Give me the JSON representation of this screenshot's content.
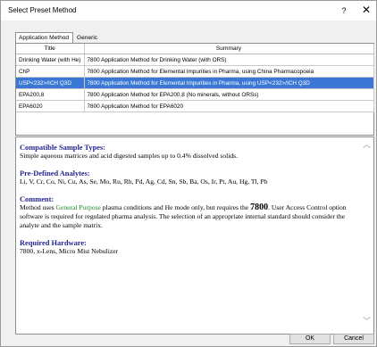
{
  "window": {
    "title": "Select Preset Method",
    "help_glyph": "?",
    "close_glyph": "✕"
  },
  "tabs": [
    {
      "label": "Application Method"
    },
    {
      "label": "Generic Method"
    }
  ],
  "table": {
    "headers": [
      "Title",
      "Summary"
    ],
    "rows": [
      {
        "title": "Drinking Water (with He)",
        "summary": "7800 Application Method for Drinking Water (with ORS)"
      },
      {
        "title": "ChP",
        "summary": "7800 Application Method for Elemental Impurities in Pharma, using China Pharmacopoeia"
      },
      {
        "title": "USP<232>/ICH Q3D",
        "summary": "7800 Application Method for Elemental Impurities in Pharma, using USP<232>/ICH Q3D"
      },
      {
        "title": "EPA200.8",
        "summary": "7800 Application Method for EPA200.8 (No minerals, without ORSs)"
      },
      {
        "title": "EPA6020",
        "summary": "7800 Application Method for EPA6020"
      }
    ],
    "selected_row": "USP<232>/ICH Q3D"
  },
  "description": {
    "compatible_heading": "Compatible Sample Types:",
    "compatible_text": "Simple aqueous matrices and acid digested samples up to 0.4% dissolved solids.",
    "analytes_heading": "Pre-Defined Analytes:",
    "analytes_text": "Li, V, Cr, Co, Ni, Cu, As, Se, Mo, Ru, Rh, Pd, Ag, Cd, Sn, Sb, Ba, Os, Ir, Pt, Au, Hg, Tl, Pb",
    "comment_heading": "Comment:",
    "comment_part1": "Method uses ",
    "comment_green": "General Purpose",
    "comment_part2": " plasma conditions and He mode only, but requires the ",
    "comment_model": "7800",
    "comment_part3": ". User Access Control option software is required for regulated pharma analysis. The selection of an appropriate internal standard should consider the analyte and the sample matrix.",
    "hardware_heading": "Required Hardware:",
    "hardware_text": "7800, x-Lens, Micro Mist Nebulizer"
  },
  "buttons": {
    "ok": "OK",
    "cancel": "Cancel"
  },
  "colors": {
    "selection": "#3b78d6",
    "heading": "#24258f",
    "highlight_green": "#1e8b2a"
  }
}
